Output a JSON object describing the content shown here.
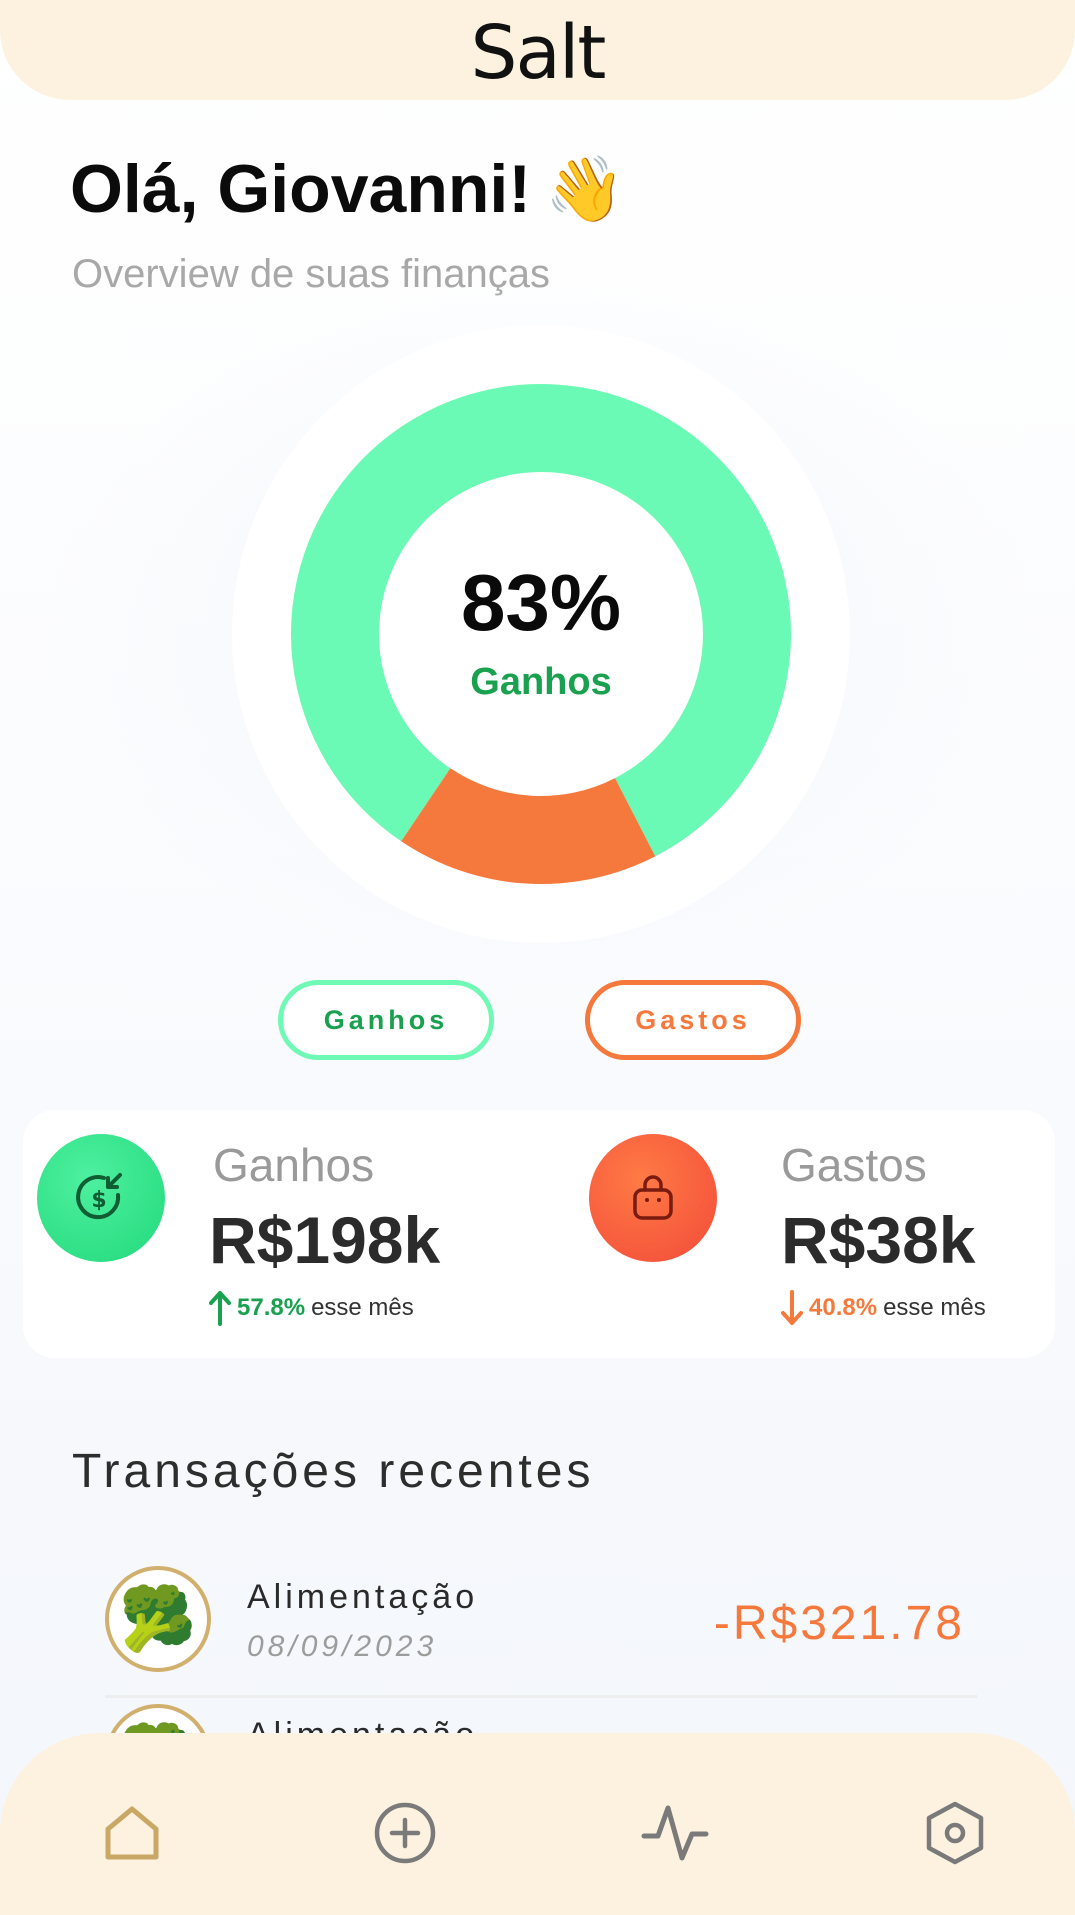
{
  "app": {
    "logo": "Salt"
  },
  "header": {
    "greeting": "Olá, Giovanni!",
    "greeting_emoji": "👋",
    "subtitle": "Overview de suas finanças"
  },
  "chart_data": {
    "type": "pie",
    "variant": "donut",
    "series": [
      {
        "name": "Ganhos",
        "value": 83,
        "color": "#6bfab5"
      },
      {
        "name": "Gastos",
        "value": 17,
        "color": "#f5793c"
      }
    ],
    "center_value": "83%",
    "center_label": "Ganhos"
  },
  "legend": {
    "ganhos_label": "Ganhos",
    "gastos_label": "Gastos"
  },
  "stats": {
    "ganhos": {
      "label": "Ganhos",
      "value": "R$198k",
      "change": "57.8%",
      "change_suffix": "esse mês",
      "direction": "up",
      "icon": "money-in-icon"
    },
    "gastos": {
      "label": "Gastos",
      "value": "R$38k",
      "change": "40.8%",
      "change_suffix": "esse mês",
      "direction": "down",
      "icon": "shopping-bag-icon"
    }
  },
  "transactions": {
    "title": "Transações recentes",
    "items": [
      {
        "category": "Alimentação",
        "date": "08/09/2023",
        "amount": "-R$321.78",
        "emoji": "🥦"
      },
      {
        "category": "Alimentação",
        "date": "",
        "amount": "",
        "emoji": "🥦"
      }
    ]
  },
  "nav": {
    "items": [
      "home-icon",
      "add-icon",
      "activity-icon",
      "settings-icon"
    ]
  },
  "colors": {
    "green": "#19a150",
    "mint": "#6bfab5",
    "orange": "#f5793c",
    "cream": "#fdf2df"
  }
}
